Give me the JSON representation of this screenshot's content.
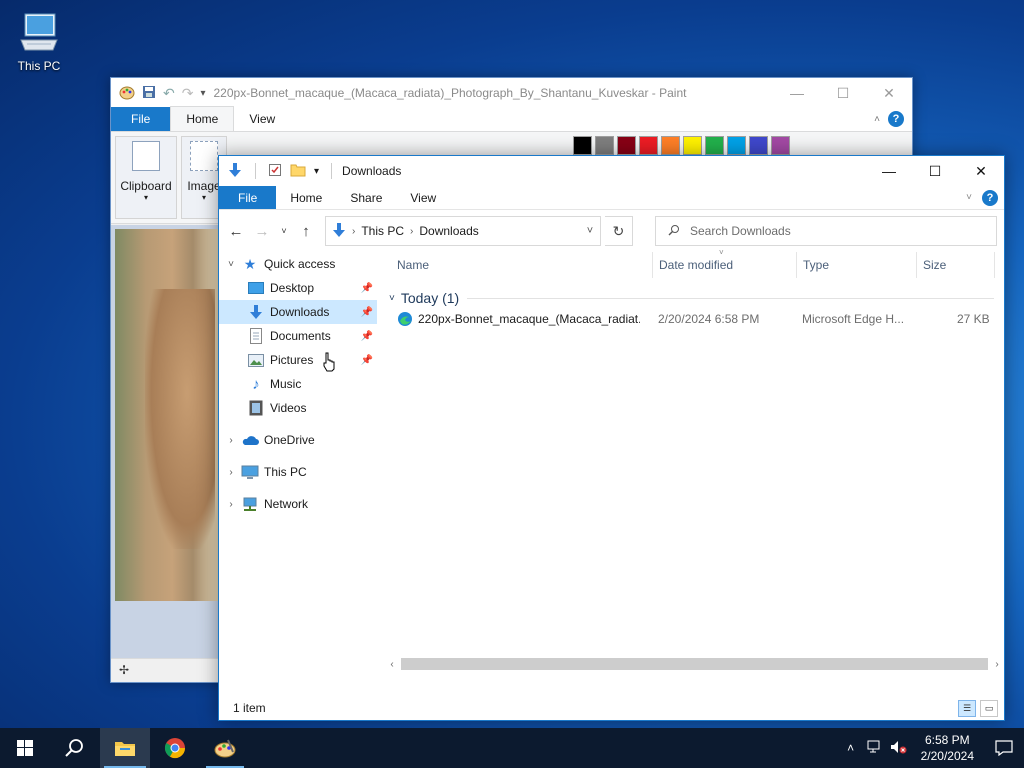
{
  "desktop": {
    "icon_label": "This PC"
  },
  "paint": {
    "title": "220px-Bonnet_macaque_(Macaca_radiata)_Photograph_By_Shantanu_Kuveskar - Paint",
    "tabs": {
      "file": "File",
      "home": "Home",
      "view": "View"
    },
    "groups": {
      "clipboard": "Clipboard",
      "image": "Image"
    },
    "palette": [
      "#000000",
      "#7f7f7f",
      "#880015",
      "#ed1c24",
      "#ff7f27",
      "#fff200",
      "#22b14c",
      "#00a2e8",
      "#3f48cc",
      "#a349a4"
    ]
  },
  "explorer": {
    "title": "Downloads",
    "tabs": {
      "file": "File",
      "home": "Home",
      "share": "Share",
      "view": "View"
    },
    "address": {
      "root": "This PC",
      "current": "Downloads"
    },
    "search": {
      "placeholder": "Search Downloads"
    },
    "nav": {
      "quick_access": "Quick access",
      "desktop": "Desktop",
      "downloads": "Downloads",
      "documents": "Documents",
      "pictures": "Pictures",
      "music": "Music",
      "videos": "Videos",
      "onedrive": "OneDrive",
      "this_pc": "This PC",
      "network": "Network"
    },
    "columns": {
      "name": "Name",
      "date": "Date modified",
      "type": "Type",
      "size": "Size"
    },
    "group": "Today (1)",
    "files": [
      {
        "name": "220px-Bonnet_macaque_(Macaca_radiat...",
        "date": "2/20/2024 6:58 PM",
        "type": "Microsoft Edge H...",
        "size": "27 KB"
      }
    ],
    "status": "1 item"
  },
  "taskbar": {
    "time": "6:58 PM",
    "date": "2/20/2024"
  },
  "colors": {
    "accent": "#1979ca",
    "selection": "#cce8ff",
    "taskbar": "#0c1a2f"
  }
}
